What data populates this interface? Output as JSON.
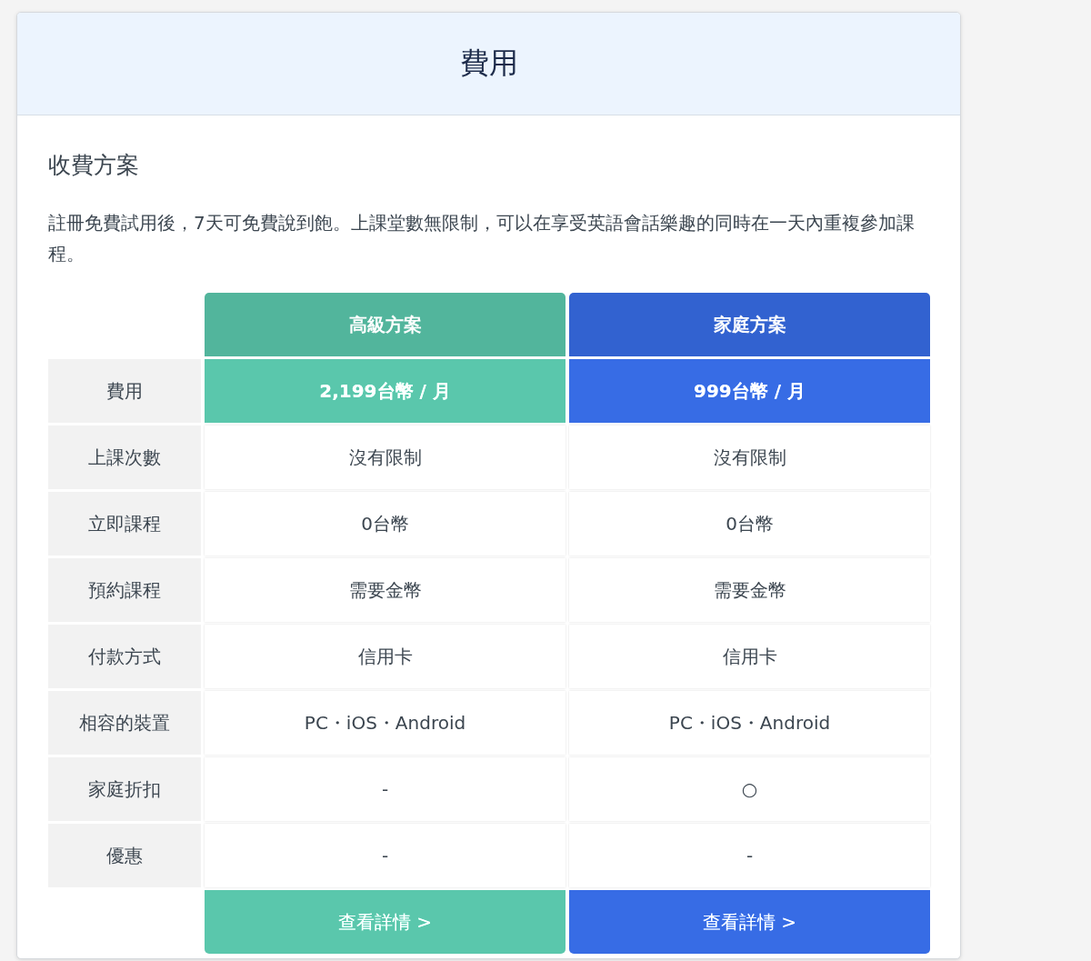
{
  "page": {
    "title": "費用"
  },
  "section": {
    "heading": "收費方案",
    "description": "註冊免費試用後，7天可免費說到飽。上課堂數無限制，可以在享受英語會話樂趣的同時在一天內重複參加課程。"
  },
  "table": {
    "row_labels": [
      "費用",
      "上課次數",
      "立即課程",
      "預約課程",
      "付款方式",
      "相容的裝置",
      "家庭折扣",
      "優惠"
    ],
    "plans": [
      {
        "name": "高級方案",
        "color": "#52b59c",
        "cells": [
          "2,199台幣 / 月",
          "沒有限制",
          "0台幣",
          "需要金幣",
          "信用卡",
          "PC・iOS・Android",
          "-",
          "-"
        ],
        "button": "查看詳情 >"
      },
      {
        "name": "家庭方案",
        "color": "#3262d0",
        "cells": [
          "999台幣 / 月",
          "沒有限制",
          "0台幣",
          "需要金幣",
          "信用卡",
          "PC・iOS・Android",
          "○",
          "-"
        ],
        "button": "查看詳情 >"
      }
    ]
  }
}
